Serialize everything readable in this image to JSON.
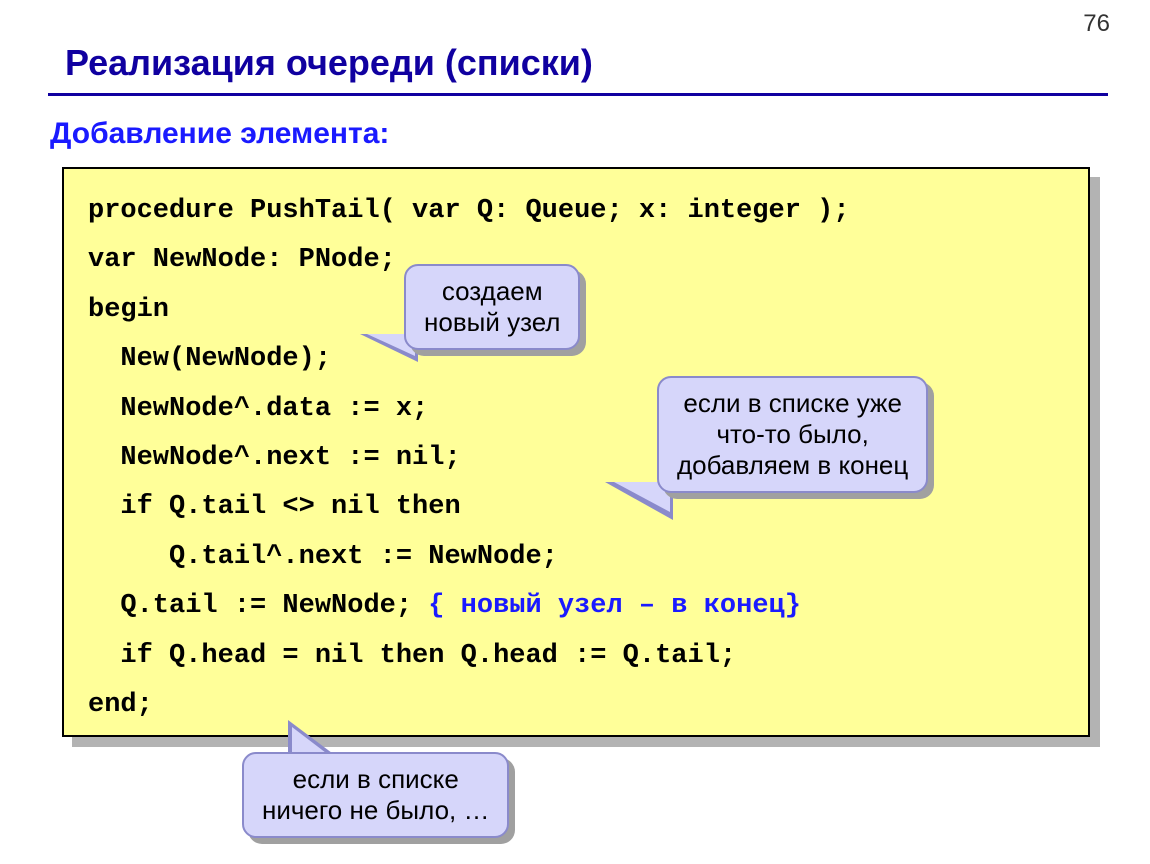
{
  "page_number": "76",
  "title": "Реализация очереди (списки)",
  "subtitle": "Добавление элемента:",
  "code": {
    "l1": "procedure PushTail( var Q: Queue; x: integer );",
    "l2": "var NewNode: PNode;",
    "l3": "begin",
    "l4": "  New(NewNode);",
    "l5": "  NewNode^.data := x;",
    "l6": "  NewNode^.next := nil;",
    "l7": "  if Q.tail <> nil then",
    "l8": "     Q.tail^.next := NewNode;",
    "l9a": "  Q.tail := NewNode; ",
    "l9b": "{ новый узел – в конец}",
    "l10": "  if Q.head = nil then Q.head := Q.tail;",
    "l11": "end;"
  },
  "callouts": {
    "c1_line1": "создаем",
    "c1_line2": "новый узел",
    "c2_line1": "если в списке уже",
    "c2_line2": "что-то было,",
    "c2_line3": "добавляем в конец",
    "c3_line1": "если в списке",
    "c3_line2": "ничего не было, …"
  }
}
